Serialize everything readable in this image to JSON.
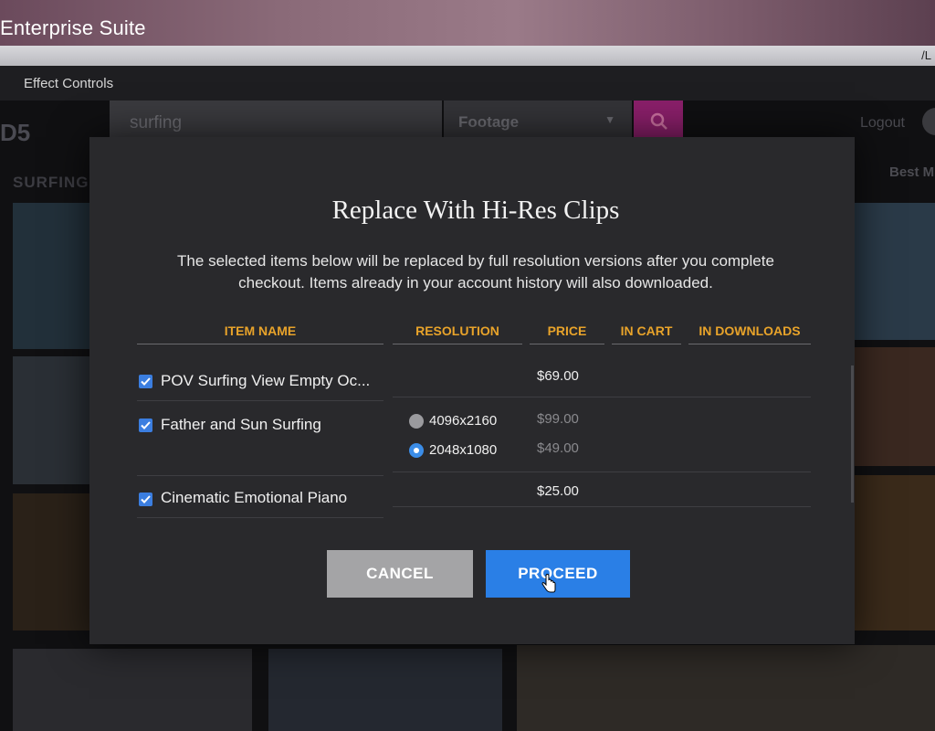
{
  "window": {
    "title": "Enterprise Suite",
    "url_fragment": "/L"
  },
  "panel": {
    "tab_label": "Effect Controls"
  },
  "app": {
    "brand": "D5",
    "search": {
      "value": "surfing"
    },
    "filter": {
      "value": "Footage"
    },
    "logout_label": "Logout",
    "category_label": "SURFING",
    "sort_label": "Best M"
  },
  "modal": {
    "title": "Replace With Hi-Res Clips",
    "description": "The selected items below will be replaced by full resolution versions after you complete checkout. Items already in your account history will also downloaded.",
    "columns": [
      "ITEM NAME",
      "RESOLUTION",
      "PRICE",
      "IN CART",
      "IN DOWNLOADS"
    ],
    "items": [
      {
        "name": "POV Surfing View Empty Oc...",
        "checked": true,
        "price": "$69.00"
      },
      {
        "name": "Father and Sun Surfing",
        "checked": true,
        "resolutions": [
          {
            "label": "4096x2160",
            "price": "$99.00",
            "selected": false
          },
          {
            "label": "2048x1080",
            "price": "$49.00",
            "selected": true
          }
        ]
      },
      {
        "name": "Cinematic Emotional Piano",
        "checked": true,
        "price": "$25.00"
      }
    ],
    "cancel_label": "CANCEL",
    "proceed_label": "PROCEED"
  },
  "colors": {
    "accent": "#2a7fe6",
    "header_gold": "#e8a32a",
    "search_button": "#8a1f6a",
    "cancel_gray": "#a4a4a6"
  },
  "icons": [
    "search-icon",
    "check-icon",
    "hand-cursor-icon",
    "chevron-down-icon"
  ]
}
